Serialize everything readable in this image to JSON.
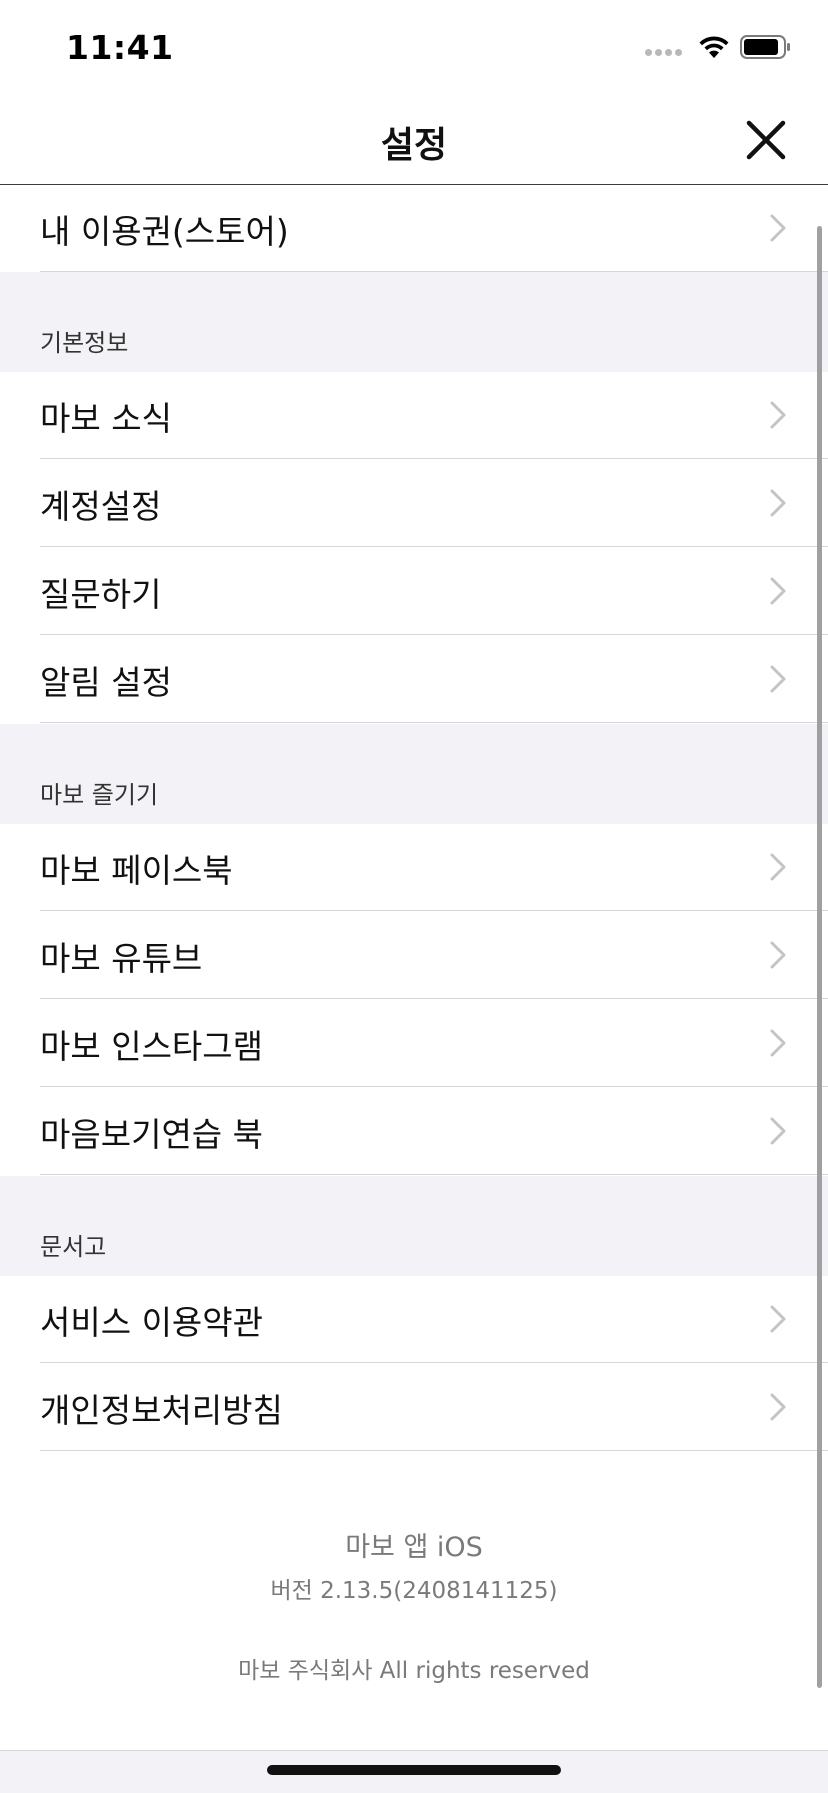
{
  "status_bar": {
    "time": "11:41",
    "icons": [
      "signal-icon",
      "wifi-icon",
      "battery-icon"
    ]
  },
  "nav": {
    "title": "설정",
    "close_icon": "close-icon"
  },
  "store_row": {
    "label": "내 이용권(스토어)"
  },
  "sections": [
    {
      "title": "기본정보",
      "items": [
        "마보 소식",
        "계정설정",
        "질문하기",
        "알림 설정"
      ]
    },
    {
      "title": "마보 즐기기",
      "items": [
        "마보 페이스북",
        "마보 유튜브",
        "마보 인스타그램",
        "마음보기연습 북"
      ]
    },
    {
      "title": "문서고",
      "items": [
        "서비스 이용약관",
        "개인정보처리방침"
      ]
    }
  ],
  "footer": {
    "app_name": "마보 앱 iOS",
    "version": "버전 2.13.5(2408141125)",
    "copyright": "마보 주식회사 All rights reserved"
  },
  "colors": {
    "section_background": "#f2f2f7",
    "separator": "#d6d6da",
    "chevron": "#c4c4c7",
    "footer_text": "#7a7a7a"
  }
}
